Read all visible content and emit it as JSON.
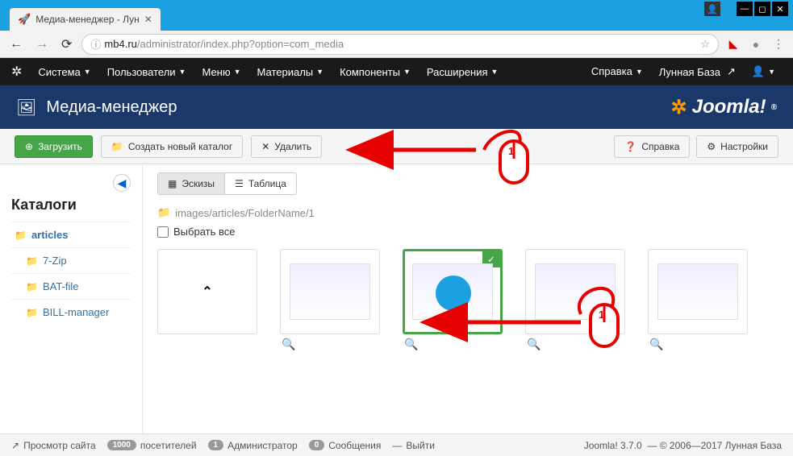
{
  "window": {
    "tab_title": "Медиа-менеджер - Лун",
    "url_host": "mb4.ru",
    "url_path": "/administrator/index.php?option=com_media"
  },
  "admin_menu": {
    "items": [
      "Система",
      "Пользователи",
      "Меню",
      "Материалы",
      "Компоненты",
      "Расширения",
      "Справка",
      "Лунная База"
    ]
  },
  "header": {
    "title": "Медиа-менеджер",
    "brand": "Joomla!"
  },
  "toolbar": {
    "upload": "Загрузить",
    "new_folder": "Создать новый каталог",
    "delete": "Удалить",
    "help": "Справка",
    "options": "Настройки"
  },
  "sidebar": {
    "heading": "Каталоги",
    "folders": [
      {
        "label": "articles",
        "sub": false,
        "bold": true
      },
      {
        "label": "7-Zip",
        "sub": true,
        "bold": false
      },
      {
        "label": "BAT-file",
        "sub": true,
        "bold": false
      },
      {
        "label": "BILL-manager",
        "sub": true,
        "bold": false
      }
    ]
  },
  "main": {
    "view_thumbs": "Эскизы",
    "view_table": "Таблица",
    "breadcrumb": "images/articles/FolderName/1",
    "select_all": "Выбрать все"
  },
  "status": {
    "preview": "Просмотр сайта",
    "visitors_count": "1000",
    "visitors_label": "посетителей",
    "admin_count": "1",
    "admin_label": "Администратор",
    "messages_count": "0",
    "messages_label": "Сообщения",
    "logout": "Выйти",
    "version": "Joomla! 3.7.0",
    "copyright": "— © 2006—2017 Лунная База"
  }
}
